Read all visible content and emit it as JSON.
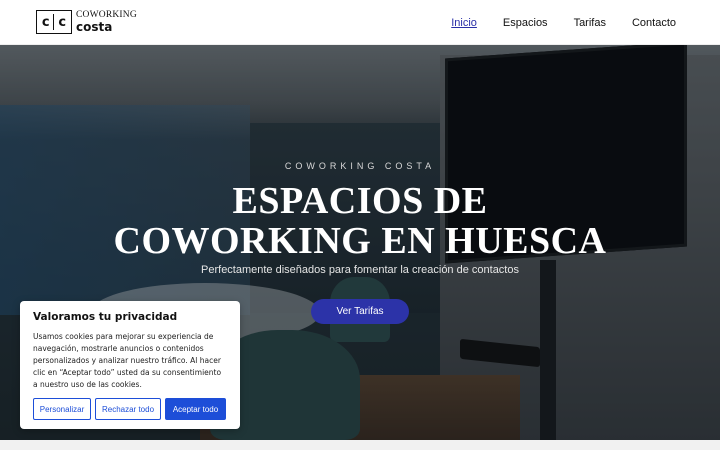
{
  "header": {
    "logo": {
      "mark_left": "c",
      "mark_right": "c",
      "line1": "COWORKING",
      "line2": "costa"
    },
    "nav": [
      {
        "label": "Inicio",
        "active": true
      },
      {
        "label": "Espacios",
        "active": false
      },
      {
        "label": "Tarifas",
        "active": false
      },
      {
        "label": "Contacto",
        "active": false
      }
    ]
  },
  "hero": {
    "eyebrow": "COWORKING COSTA",
    "title_line1": "ESPACIOS DE",
    "title_line2": "COWORKING EN HUESCA",
    "subtitle": "Perfectamente diseñados para fomentar la creación de contactos",
    "cta_label": "Ver Tarifas"
  },
  "cookie": {
    "title": "Valoramos tu privacidad",
    "text": "Usamos cookies para mejorar su experiencia de navegación, mostrarle anuncios o contenidos personalizados y analizar nuestro tráfico. Al hacer clic en “Aceptar todo” usted da su consentimiento a nuestro uso de las cookies.",
    "buttons": {
      "customize": "Personalizar",
      "reject": "Rechazar todo",
      "accept": "Aceptar todo"
    }
  },
  "colors": {
    "accent": "#2c33a8",
    "cookie_accent": "#1d4ed8"
  }
}
